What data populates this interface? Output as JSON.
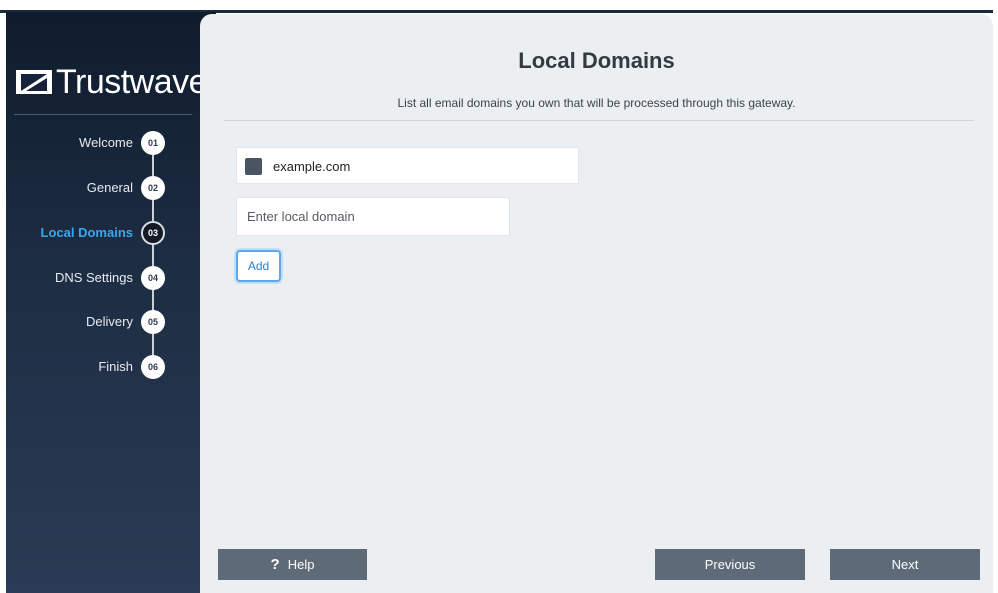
{
  "brand": {
    "name": "Trustwave",
    "reg": "®"
  },
  "steps": [
    {
      "label": "Welcome",
      "num": "01"
    },
    {
      "label": "General",
      "num": "02"
    },
    {
      "label": "Local Domains",
      "num": "03",
      "active": true
    },
    {
      "label": "DNS Settings",
      "num": "04"
    },
    {
      "label": "Delivery",
      "num": "05"
    },
    {
      "label": "Finish",
      "num": "06"
    }
  ],
  "main": {
    "title": "Local Domains",
    "subtitle": "List all email domains you own that will be processed through this gateway.",
    "domains": [
      {
        "name": "example.com"
      }
    ],
    "input": {
      "placeholder": "Enter local domain",
      "value": ""
    },
    "add_label": "Add"
  },
  "footer": {
    "help_icon": "?",
    "help_label": "Help",
    "previous_label": "Previous",
    "next_label": "Next"
  },
  "colors": {
    "sidebar": "#1d2d43",
    "active_step": "#39a7f0",
    "button": "#5e6a78",
    "panel": "#eceff2"
  }
}
